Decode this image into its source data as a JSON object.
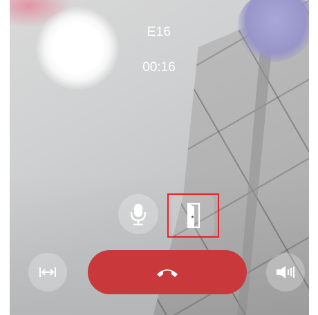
{
  "call": {
    "caller_name": "E16",
    "duration": "00:16"
  },
  "controls": {
    "mic_icon": "microphone-icon",
    "door_icon": "door-open-icon",
    "width_icon": "expand-horizontal-icon",
    "hangup_icon": "phone-hangup-icon",
    "speaker_icon": "speaker-icon"
  },
  "colors": {
    "hangup": "#c9383b",
    "highlight": "#e32525"
  }
}
